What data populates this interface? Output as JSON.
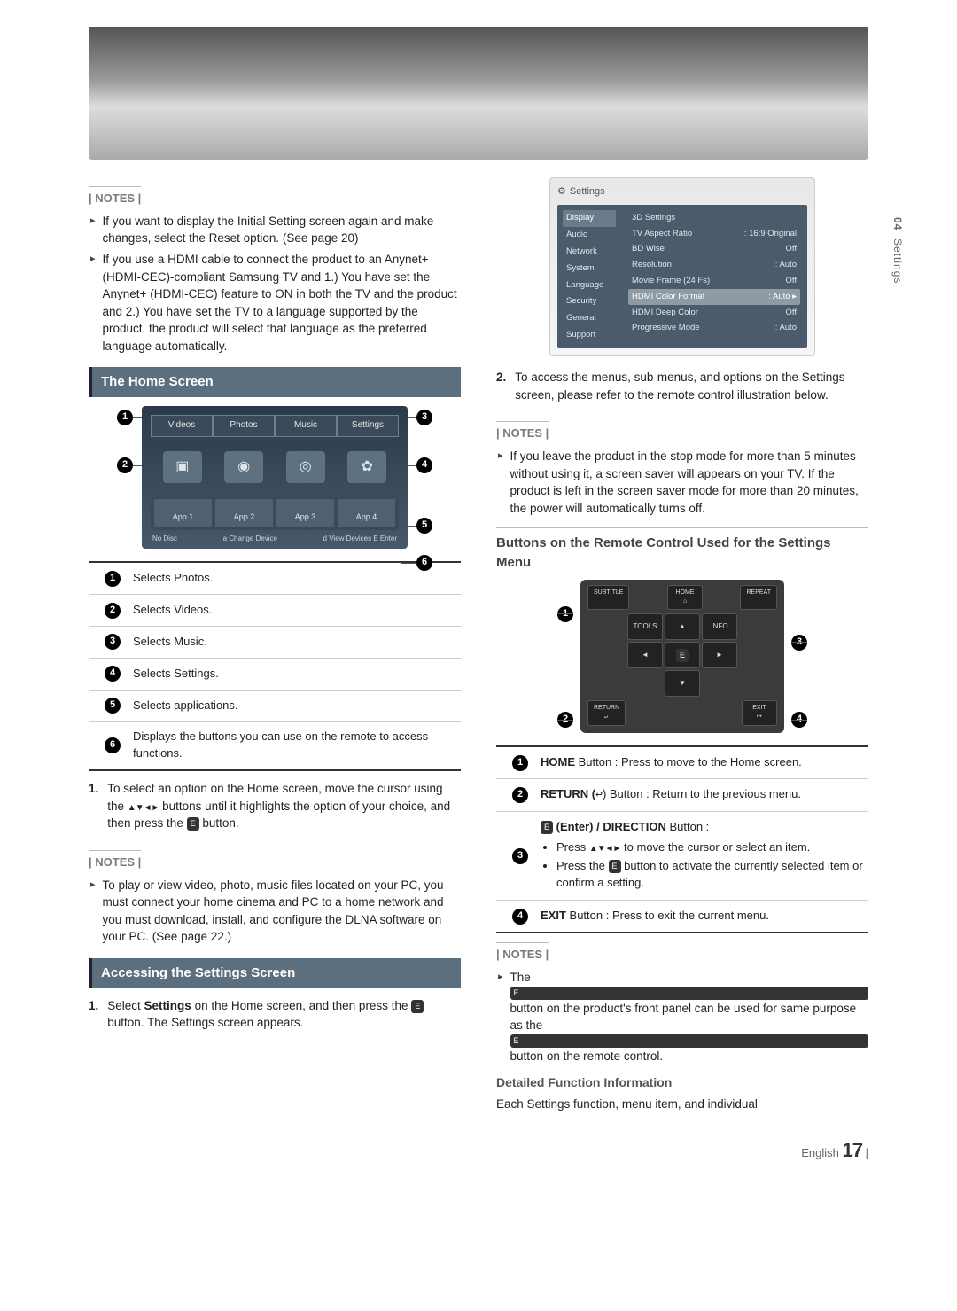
{
  "sideTab": {
    "num": "04",
    "label": "Settings"
  },
  "notesLabel": "| NOTES |",
  "topNotes": [
    "If you want to display the Initial Setting screen again and make changes, select the Reset option. (See page 20)",
    "If you use a HDMI cable to connect the product to an Anynet+ (HDMI-CEC)-compliant Samsung TV and 1.) You have set the Anynet+ (HDMI-CEC) feature to ON in both the TV and the product and 2.) You have set the TV to a language supported by the product, the product will select that language as the preferred language automatically."
  ],
  "section1": "The Home Screen",
  "homeUI": {
    "tabs": [
      "Videos",
      "Photos",
      "Music",
      "Settings"
    ],
    "apps": [
      "App 1",
      "App 2",
      "App 3",
      "App 4"
    ],
    "statusLeft": "No Disc",
    "statusChange": "a Change Device",
    "statusRight": "d View Devices  E Enter"
  },
  "homeLegend": [
    "Selects Photos.",
    "Selects Videos.",
    "Selects Music.",
    "Selects Settings.",
    "Selects applications.",
    "Displays the buttons you can use on the remote to access functions."
  ],
  "homeStep": {
    "num": "1.",
    "text_a": "To select an option on the Home screen, move the cursor using the ",
    "arrows": "▲▼◄►",
    "text_b": " buttons until it highlights the option of your choice, and then press the ",
    "text_c": " button."
  },
  "homeNote": "To play or view video, photo, music files located on your PC, you must connect your home cinema and PC to a home network and you must download, install, and configure the DLNA software on your PC. (See page 22.)",
  "section2": "Accessing the Settings Screen",
  "settingsStep1": {
    "num": "1.",
    "text_a": "Select ",
    "bold": "Settings",
    "text_b": " on the Home screen, and then press the ",
    "text_c": " button. The Settings screen appears."
  },
  "settingsUI": {
    "title": "Settings",
    "menu": [
      "Display",
      "Audio",
      "Network",
      "System",
      "Language",
      "Security",
      "General",
      "Support"
    ],
    "rows": [
      {
        "k": "3D Settings",
        "v": ""
      },
      {
        "k": "TV Aspect Ratio",
        "v": ": 16:9 Original"
      },
      {
        "k": "BD Wise",
        "v": ": Off"
      },
      {
        "k": "Resolution",
        "v": ": Auto"
      },
      {
        "k": "Movie Frame (24 Fs)",
        "v": ": Off"
      },
      {
        "k": "HDMI Color Format",
        "v": ": Auto"
      },
      {
        "k": "HDMI Deep Color",
        "v": ": Off"
      },
      {
        "k": "Progressive Mode",
        "v": ": Auto"
      }
    ],
    "selectedRow": 5
  },
  "settingsStep2": {
    "num": "2.",
    "text": "To access the menus, sub-menus, and options on the Settings screen, please refer to the remote control illustration below."
  },
  "settingsNote": "If you leave the product in the stop mode for more than 5 minutes without using it, a screen saver will appears on your TV. If the product is left in the screen saver mode for more than 20 minutes, the power will automatically turns off.",
  "remoteHeading": "Buttons on the Remote Control Used for the Settings Menu",
  "remote": {
    "top": [
      "SUBTITLE",
      "HOME",
      "REPEAT"
    ],
    "midTools": "TOOLS",
    "midInfo": "INFO",
    "botReturn": "RETURN",
    "botExit": "EXIT"
  },
  "remoteLegend": [
    {
      "pre": "HOME",
      "body": " Button : Press to move to the Home screen."
    },
    {
      "pre": "RETURN (",
      "mid": "↩",
      "post": ") Button : Return to the previous menu."
    },
    {
      "pre": "E",
      "lead": " (Enter) / DIRECTION",
      "body": " Button :",
      "li1_a": "Press ",
      "li1_arrows": "▲▼◄►",
      "li1_b": " to move the cursor or select an item.",
      "li2_a": "Press the ",
      "li2_b": " button to activate the currently selected item or confirm a setting."
    },
    {
      "pre": "EXIT",
      "body": " Button : Press to exit the current menu."
    }
  ],
  "remoteNote_a": "The ",
  "remoteNote_b": " button on the product's front panel can be used for same purpose as the ",
  "remoteNote_c": " button on the remote control.",
  "detailHead": "Detailed Function Information",
  "detailBody": "Each Settings function, menu item, and individual",
  "pageFoot": {
    "lang": "English",
    "num": "17",
    "bar": "|"
  },
  "enterGlyph": "E"
}
